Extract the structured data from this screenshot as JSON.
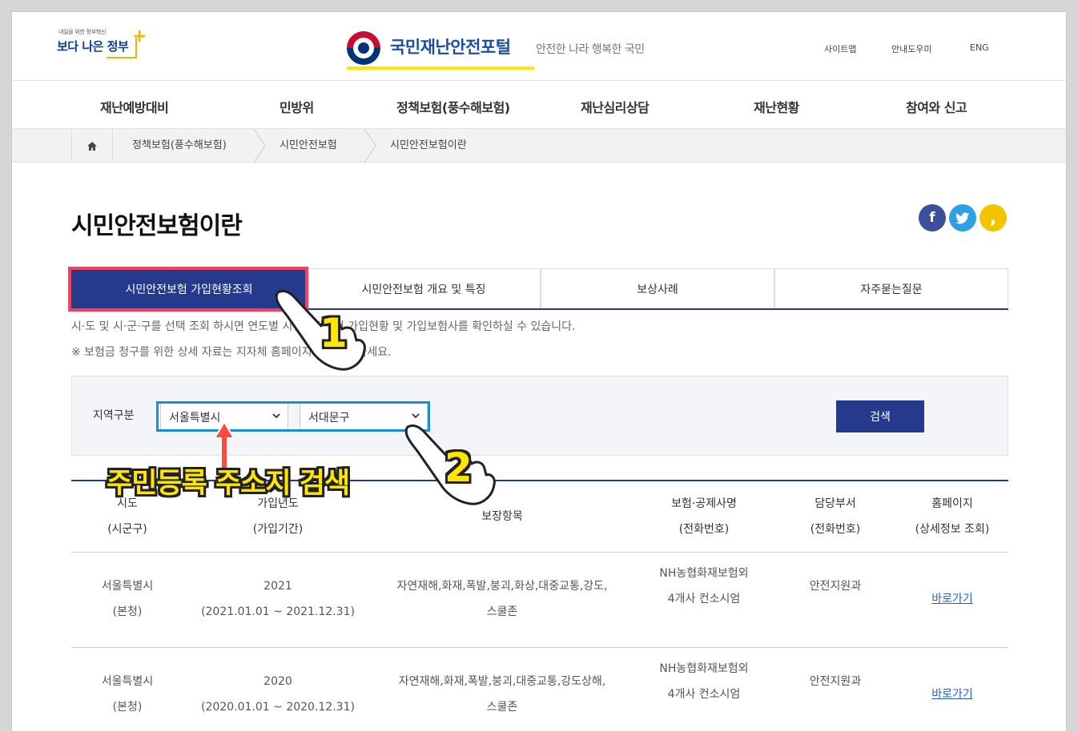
{
  "header": {
    "gov_small": "내일을 위한 정부혁신",
    "gov_small_accent": "정부혁신",
    "gov_big": "보다 나은 정부",
    "portal_title": "국민재난안전포털",
    "portal_sub": "안전한 나라 행복한 국민",
    "util": [
      "사이트맵",
      "안내도우미",
      "ENG"
    ]
  },
  "gnb": [
    "재난예방대비",
    "민방위",
    "정책보험(풍수해보험)",
    "재난심리상담",
    "재난현황",
    "참여와 신고"
  ],
  "breadcrumb": [
    "정책보험(풍수해보험)",
    "시민안전보험",
    "시민안전보험이란"
  ],
  "page_title": "시민안전보험이란",
  "sns": [
    {
      "icon": "facebook-icon",
      "glyph": "f",
      "color": "#3b4f9a"
    },
    {
      "icon": "twitter-icon",
      "glyph": "t",
      "color": "#2ea1e6"
    },
    {
      "icon": "kakaostory-icon",
      "glyph": ",",
      "color": "#f5c400"
    }
  ],
  "tabs": [
    "시민안전보험 가입현황조회",
    "시민안전보험 개요 및 특징",
    "보상사례",
    "자주묻는질문"
  ],
  "desc": [
    "시·도 및 시·군·구를 선택 조회 하시면 연도별 시민안전보험 가입현황 및 가입보험사를 확인하실 수 있습니다.",
    "※ 보험금 청구를 위한 상세 자료는 지자체 홈페이지에서 확인하세요."
  ],
  "search": {
    "label": "지역구분",
    "sido": "서울특별시",
    "sigungu": "서대문구",
    "button": "검색"
  },
  "table": {
    "headers": [
      [
        "시도",
        "(시군구)"
      ],
      [
        "가입년도",
        "(가입기간)"
      ],
      [
        "보장항목"
      ],
      [
        "보험·공제사명",
        "(전화번호)"
      ],
      [
        "담당부서",
        "(전화번호)"
      ],
      [
        "홈페이지",
        "(상세정보 조회)"
      ]
    ],
    "rows": [
      {
        "sido": [
          "서울특별시",
          "(본청)"
        ],
        "year": [
          "2021",
          "(2021.01.01 ~ 2021.12.31)"
        ],
        "coverage": [
          "자연재해,화재,폭발,붕괴,화상,대중교통,강도,",
          "스쿨존"
        ],
        "insurer": [
          "NH농협화재보험외",
          "4개사 컨소시엄"
        ],
        "dept": "안전지원과",
        "link": "바로가기"
      },
      {
        "sido": [
          "서울특별시",
          "(본청)"
        ],
        "year": [
          "2020",
          "(2020.01.01 ~ 2020.12.31)"
        ],
        "coverage": [
          "자연재해,화재,폭발,붕괴,대중교통,강도상해,",
          "스쿨존"
        ],
        "insurer": [
          "NH농협화재보험외",
          "4개사 컨소시엄"
        ],
        "dept": "안전지원과",
        "link": "바로가기"
      }
    ]
  },
  "annotations": {
    "step1": "1",
    "step2": "2",
    "caption": "주민등록 주소지 검색",
    "highlight_tab_color": "#ff3d5a",
    "highlight_select_color": "#1a8fd6"
  }
}
